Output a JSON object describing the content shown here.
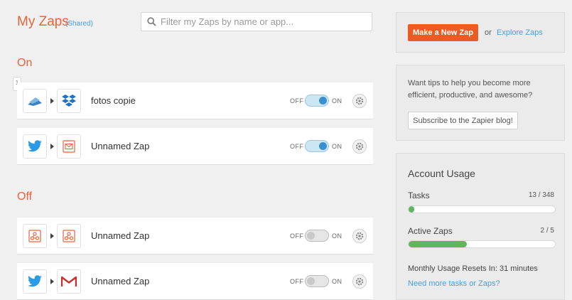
{
  "header": {
    "title": "My Zaps",
    "shared": "(Shared)",
    "search_placeholder": "Filter my Zaps by name or app..."
  },
  "sections": {
    "on_label": "On",
    "off_label": "Off",
    "badge": "1"
  },
  "toggle_labels": {
    "off": "OFF",
    "on": "ON"
  },
  "zaps": [
    {
      "name": "fotos copie",
      "trigger_app": "cloud-storage-icon",
      "action_app": "dropbox-icon",
      "state": "on"
    },
    {
      "name": "Unnamed Zap",
      "trigger_app": "twitter-icon",
      "action_app": "email-icon",
      "state": "on"
    },
    {
      "name": "Unnamed Zap",
      "trigger_app": "webhook-icon",
      "action_app": "webhook-icon",
      "state": "off"
    },
    {
      "name": "Unnamed Zap",
      "trigger_app": "twitter-icon",
      "action_app": "gmail-icon",
      "state": "off"
    }
  ],
  "actions": {
    "make_button": "Make a New Zap",
    "or_text": "or",
    "explore_link": "Explore Zaps"
  },
  "tips": {
    "text": "Want tips to help you become more efficient, productive, and awesome?",
    "subscribe_button": "Subscribe to the Zapier blog!"
  },
  "usage": {
    "title": "Account Usage",
    "tasks_label": "Tasks",
    "tasks_value": "13 / 348",
    "tasks_fraction": 0.037,
    "active_label": "Active Zaps",
    "active_value": "2 / 5",
    "active_fraction": 0.4,
    "reset_text": "Monthly Usage Resets In: 31 minutes",
    "more_link": "Need more tasks or Zaps?"
  },
  "colors": {
    "accent": "#e8643c",
    "button": "#ec5b24",
    "link": "#4a9fd5",
    "bar_fill": "#5cb85c",
    "toggle_on": "#3a8fd0"
  }
}
